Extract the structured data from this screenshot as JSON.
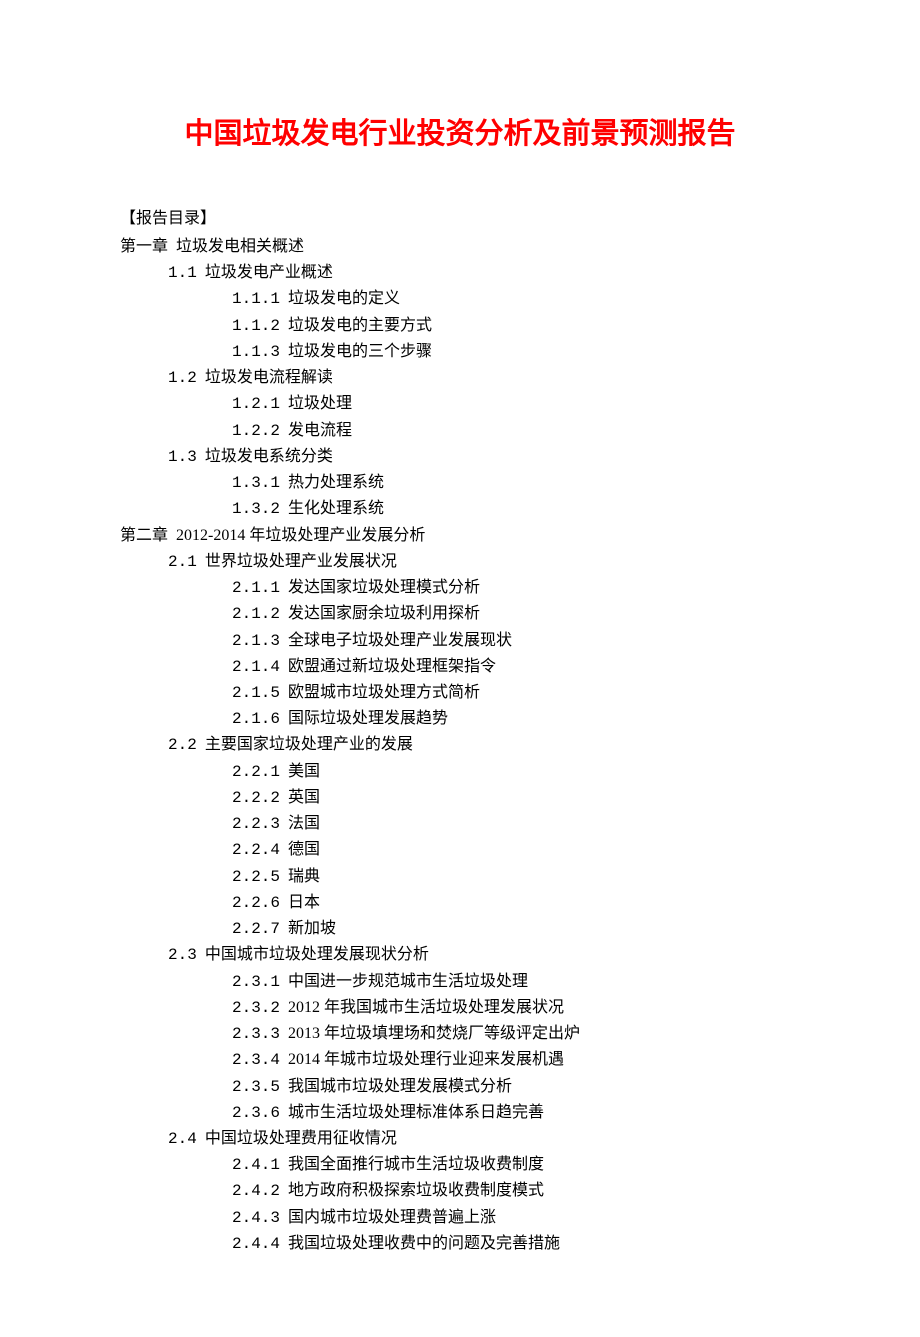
{
  "title": "中国垃圾发电行业投资分析及前景预测报告",
  "toc_label": "【报告目录】",
  "toc": [
    {
      "level": "chapter",
      "num": "第一章",
      "text": "垃圾发电相关概述"
    },
    {
      "level": "section",
      "num": "1.1",
      "text": "垃圾发电产业概述"
    },
    {
      "level": "subsection",
      "num": "1.1.1",
      "text": "垃圾发电的定义"
    },
    {
      "level": "subsection",
      "num": "1.1.2",
      "text": "垃圾发电的主要方式"
    },
    {
      "level": "subsection",
      "num": "1.1.3",
      "text": "垃圾发电的三个步骤"
    },
    {
      "level": "section",
      "num": "1.2",
      "text": "垃圾发电流程解读"
    },
    {
      "level": "subsection",
      "num": "1.2.1",
      "text": "垃圾处理"
    },
    {
      "level": "subsection",
      "num": "1.2.2",
      "text": "发电流程"
    },
    {
      "level": "section",
      "num": "1.3",
      "text": "垃圾发电系统分类"
    },
    {
      "level": "subsection",
      "num": "1.3.1",
      "text": "热力处理系统"
    },
    {
      "level": "subsection",
      "num": "1.3.2",
      "text": "生化处理系统"
    },
    {
      "level": "chapter",
      "num": "第二章",
      "text": "2012-2014 年垃圾处理产业发展分析"
    },
    {
      "level": "section",
      "num": "2.1",
      "text": "世界垃圾处理产业发展状况"
    },
    {
      "level": "subsection",
      "num": "2.1.1",
      "text": "发达国家垃圾处理模式分析"
    },
    {
      "level": "subsection",
      "num": "2.1.2",
      "text": "发达国家厨余垃圾利用探析"
    },
    {
      "level": "subsection",
      "num": "2.1.3",
      "text": "全球电子垃圾处理产业发展现状"
    },
    {
      "level": "subsection",
      "num": "2.1.4",
      "text": "欧盟通过新垃圾处理框架指令"
    },
    {
      "level": "subsection",
      "num": "2.1.5",
      "text": "欧盟城市垃圾处理方式简析"
    },
    {
      "level": "subsection",
      "num": "2.1.6",
      "text": "国际垃圾处理发展趋势"
    },
    {
      "level": "section",
      "num": "2.2",
      "text": "主要国家垃圾处理产业的发展"
    },
    {
      "level": "subsection",
      "num": "2.2.1",
      "text": "美国"
    },
    {
      "level": "subsection",
      "num": "2.2.2",
      "text": "英国"
    },
    {
      "level": "subsection",
      "num": "2.2.3",
      "text": "法国"
    },
    {
      "level": "subsection",
      "num": "2.2.4",
      "text": "德国"
    },
    {
      "level": "subsection",
      "num": "2.2.5",
      "text": "瑞典"
    },
    {
      "level": "subsection",
      "num": "2.2.6",
      "text": "日本"
    },
    {
      "level": "subsection",
      "num": "2.2.7",
      "text": "新加坡"
    },
    {
      "level": "section",
      "num": "2.3",
      "text": "中国城市垃圾处理发展现状分析"
    },
    {
      "level": "subsection",
      "num": "2.3.1",
      "text": "中国进一步规范城市生活垃圾处理"
    },
    {
      "level": "subsection",
      "num": "2.3.2",
      "text": "2012 年我国城市生活垃圾处理发展状况"
    },
    {
      "level": "subsection",
      "num": "2.3.3",
      "text": "2013 年垃圾填埋场和焚烧厂等级评定出炉"
    },
    {
      "level": "subsection",
      "num": "2.3.4",
      "text": "2014 年城市垃圾处理行业迎来发展机遇"
    },
    {
      "level": "subsection",
      "num": "2.3.5",
      "text": "我国城市垃圾处理发展模式分析"
    },
    {
      "level": "subsection",
      "num": "2.3.6",
      "text": "城市生活垃圾处理标准体系日趋完善"
    },
    {
      "level": "section",
      "num": "2.4",
      "text": "中国垃圾处理费用征收情况"
    },
    {
      "level": "subsection",
      "num": "2.4.1",
      "text": "我国全面推行城市生活垃圾收费制度"
    },
    {
      "level": "subsection",
      "num": "2.4.2",
      "text": "地方政府积极探索垃圾收费制度模式"
    },
    {
      "level": "subsection",
      "num": "2.4.3",
      "text": "国内城市垃圾处理费普遍上涨"
    },
    {
      "level": "subsection",
      "num": "2.4.4",
      "text": "我国垃圾处理收费中的问题及完善措施"
    }
  ]
}
